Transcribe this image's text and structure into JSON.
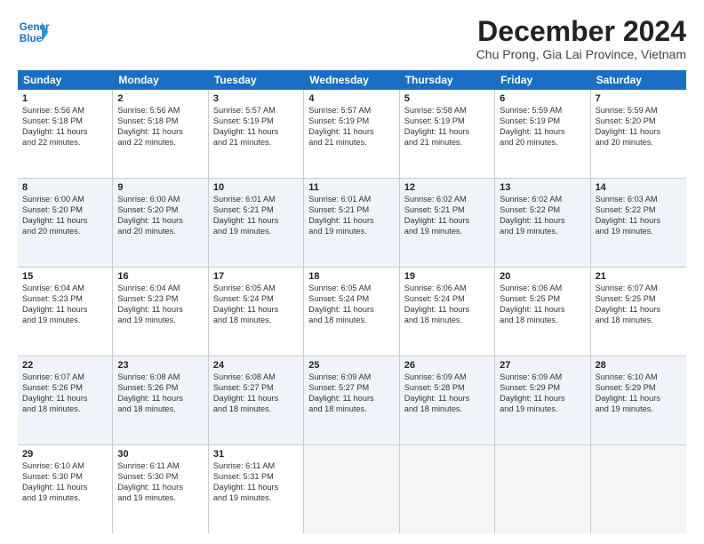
{
  "header": {
    "logo_line1": "General",
    "logo_line2": "Blue",
    "title": "December 2024",
    "subtitle": "Chu Prong, Gia Lai Province, Vietnam"
  },
  "weekdays": [
    "Sunday",
    "Monday",
    "Tuesday",
    "Wednesday",
    "Thursday",
    "Friday",
    "Saturday"
  ],
  "rows": [
    [
      {
        "day": "1",
        "lines": [
          "Sunrise: 5:56 AM",
          "Sunset: 5:18 PM",
          "Daylight: 11 hours",
          "and 22 minutes."
        ]
      },
      {
        "day": "2",
        "lines": [
          "Sunrise: 5:56 AM",
          "Sunset: 5:18 PM",
          "Daylight: 11 hours",
          "and 22 minutes."
        ]
      },
      {
        "day": "3",
        "lines": [
          "Sunrise: 5:57 AM",
          "Sunset: 5:19 PM",
          "Daylight: 11 hours",
          "and 21 minutes."
        ]
      },
      {
        "day": "4",
        "lines": [
          "Sunrise: 5:57 AM",
          "Sunset: 5:19 PM",
          "Daylight: 11 hours",
          "and 21 minutes."
        ]
      },
      {
        "day": "5",
        "lines": [
          "Sunrise: 5:58 AM",
          "Sunset: 5:19 PM",
          "Daylight: 11 hours",
          "and 21 minutes."
        ]
      },
      {
        "day": "6",
        "lines": [
          "Sunrise: 5:59 AM",
          "Sunset: 5:19 PM",
          "Daylight: 11 hours",
          "and 20 minutes."
        ]
      },
      {
        "day": "7",
        "lines": [
          "Sunrise: 5:59 AM",
          "Sunset: 5:20 PM",
          "Daylight: 11 hours",
          "and 20 minutes."
        ]
      }
    ],
    [
      {
        "day": "8",
        "lines": [
          "Sunrise: 6:00 AM",
          "Sunset: 5:20 PM",
          "Daylight: 11 hours",
          "and 20 minutes."
        ]
      },
      {
        "day": "9",
        "lines": [
          "Sunrise: 6:00 AM",
          "Sunset: 5:20 PM",
          "Daylight: 11 hours",
          "and 20 minutes."
        ]
      },
      {
        "day": "10",
        "lines": [
          "Sunrise: 6:01 AM",
          "Sunset: 5:21 PM",
          "Daylight: 11 hours",
          "and 19 minutes."
        ]
      },
      {
        "day": "11",
        "lines": [
          "Sunrise: 6:01 AM",
          "Sunset: 5:21 PM",
          "Daylight: 11 hours",
          "and 19 minutes."
        ]
      },
      {
        "day": "12",
        "lines": [
          "Sunrise: 6:02 AM",
          "Sunset: 5:21 PM",
          "Daylight: 11 hours",
          "and 19 minutes."
        ]
      },
      {
        "day": "13",
        "lines": [
          "Sunrise: 6:02 AM",
          "Sunset: 5:22 PM",
          "Daylight: 11 hours",
          "and 19 minutes."
        ]
      },
      {
        "day": "14",
        "lines": [
          "Sunrise: 6:03 AM",
          "Sunset: 5:22 PM",
          "Daylight: 11 hours",
          "and 19 minutes."
        ]
      }
    ],
    [
      {
        "day": "15",
        "lines": [
          "Sunrise: 6:04 AM",
          "Sunset: 5:23 PM",
          "Daylight: 11 hours",
          "and 19 minutes."
        ]
      },
      {
        "day": "16",
        "lines": [
          "Sunrise: 6:04 AM",
          "Sunset: 5:23 PM",
          "Daylight: 11 hours",
          "and 19 minutes."
        ]
      },
      {
        "day": "17",
        "lines": [
          "Sunrise: 6:05 AM",
          "Sunset: 5:24 PM",
          "Daylight: 11 hours",
          "and 18 minutes."
        ]
      },
      {
        "day": "18",
        "lines": [
          "Sunrise: 6:05 AM",
          "Sunset: 5:24 PM",
          "Daylight: 11 hours",
          "and 18 minutes."
        ]
      },
      {
        "day": "19",
        "lines": [
          "Sunrise: 6:06 AM",
          "Sunset: 5:24 PM",
          "Daylight: 11 hours",
          "and 18 minutes."
        ]
      },
      {
        "day": "20",
        "lines": [
          "Sunrise: 6:06 AM",
          "Sunset: 5:25 PM",
          "Daylight: 11 hours",
          "and 18 minutes."
        ]
      },
      {
        "day": "21",
        "lines": [
          "Sunrise: 6:07 AM",
          "Sunset: 5:25 PM",
          "Daylight: 11 hours",
          "and 18 minutes."
        ]
      }
    ],
    [
      {
        "day": "22",
        "lines": [
          "Sunrise: 6:07 AM",
          "Sunset: 5:26 PM",
          "Daylight: 11 hours",
          "and 18 minutes."
        ]
      },
      {
        "day": "23",
        "lines": [
          "Sunrise: 6:08 AM",
          "Sunset: 5:26 PM",
          "Daylight: 11 hours",
          "and 18 minutes."
        ]
      },
      {
        "day": "24",
        "lines": [
          "Sunrise: 6:08 AM",
          "Sunset: 5:27 PM",
          "Daylight: 11 hours",
          "and 18 minutes."
        ]
      },
      {
        "day": "25",
        "lines": [
          "Sunrise: 6:09 AM",
          "Sunset: 5:27 PM",
          "Daylight: 11 hours",
          "and 18 minutes."
        ]
      },
      {
        "day": "26",
        "lines": [
          "Sunrise: 6:09 AM",
          "Sunset: 5:28 PM",
          "Daylight: 11 hours",
          "and 18 minutes."
        ]
      },
      {
        "day": "27",
        "lines": [
          "Sunrise: 6:09 AM",
          "Sunset: 5:29 PM",
          "Daylight: 11 hours",
          "and 19 minutes."
        ]
      },
      {
        "day": "28",
        "lines": [
          "Sunrise: 6:10 AM",
          "Sunset: 5:29 PM",
          "Daylight: 11 hours",
          "and 19 minutes."
        ]
      }
    ],
    [
      {
        "day": "29",
        "lines": [
          "Sunrise: 6:10 AM",
          "Sunset: 5:30 PM",
          "Daylight: 11 hours",
          "and 19 minutes."
        ]
      },
      {
        "day": "30",
        "lines": [
          "Sunrise: 6:11 AM",
          "Sunset: 5:30 PM",
          "Daylight: 11 hours",
          "and 19 minutes."
        ]
      },
      {
        "day": "31",
        "lines": [
          "Sunrise: 6:11 AM",
          "Sunset: 5:31 PM",
          "Daylight: 11 hours",
          "and 19 minutes."
        ]
      },
      {
        "day": "",
        "lines": []
      },
      {
        "day": "",
        "lines": []
      },
      {
        "day": "",
        "lines": []
      },
      {
        "day": "",
        "lines": []
      }
    ]
  ]
}
